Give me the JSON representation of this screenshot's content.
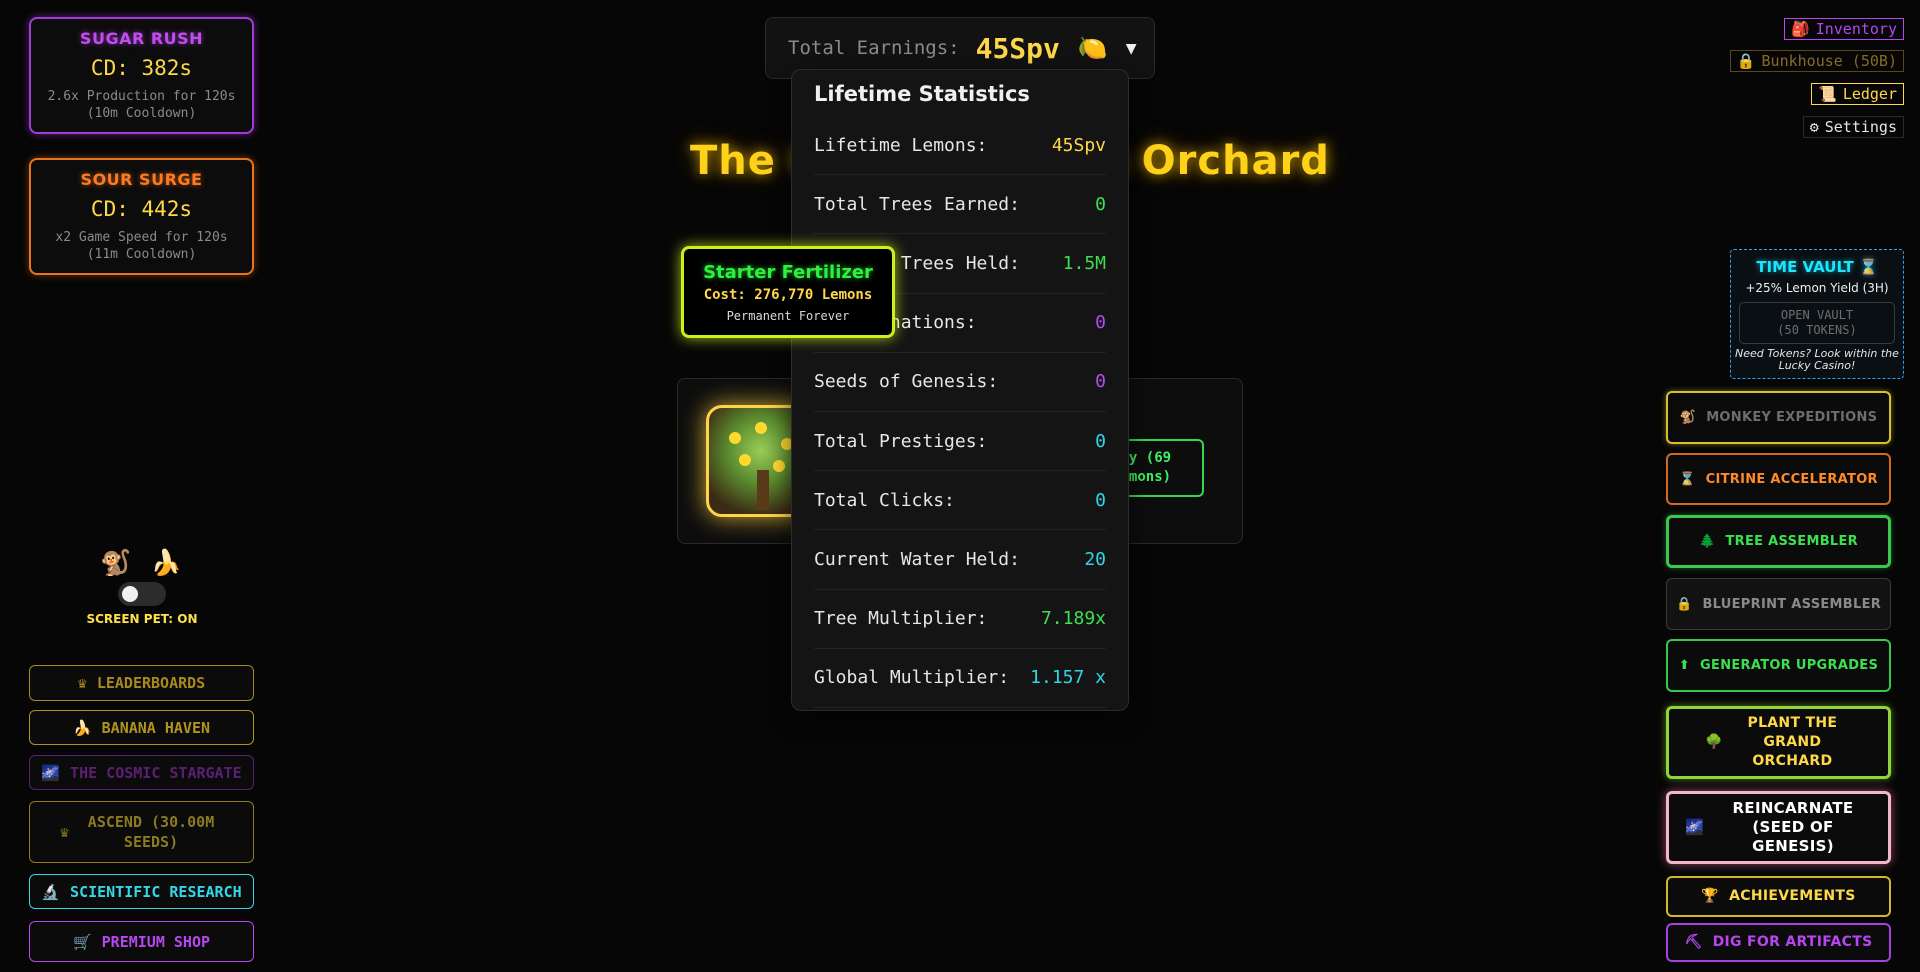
{
  "abilities": {
    "sugar": {
      "title": "SUGAR RUSH",
      "cd": "CD: 382s",
      "desc1": "2.6x Production for 120s",
      "desc2": "(10m Cooldown)"
    },
    "sour": {
      "title": "SOUR SURGE",
      "cd": "CD: 442s",
      "desc1": "x2 Game Speed for 120s",
      "desc2": "(11m Cooldown)"
    }
  },
  "pet": {
    "emojis": "🐒 🍌",
    "label": "SCREEN PET: ON",
    "toggle_on": true
  },
  "left_nav": [
    {
      "icon": "♛",
      "label": "LEADERBOARDS",
      "color": "#a8891e"
    },
    {
      "icon": "🍌",
      "label": "BANANA HAVEN",
      "color": "#b0921f"
    },
    {
      "icon": "🌌",
      "label": "THE COSMIC STARGATE",
      "color": "#5b1f73"
    },
    {
      "icon": "♛",
      "label": "ASCEND (30.00M SEEDS)",
      "color": "#8b7a22"
    },
    {
      "icon": "🔬",
      "label": "SCIENTIFIC RESEARCH",
      "color": "#35d6e8"
    },
    {
      "icon": "🛒",
      "label": "PREMIUM SHOP",
      "color": "#b546f0"
    }
  ],
  "earnings": {
    "label": "Total Earnings:",
    "value": "45Spv",
    "icon": "🍋",
    "caret": "▼"
  },
  "game_title": "The Cosmic Lemon Orchard",
  "buy_button": "y (69\nmons)",
  "stats": {
    "title": "Lifetime Statistics",
    "rows": [
      {
        "key": "Lifetime Lemons:",
        "value": "45Spv",
        "color": "#ffd84a"
      },
      {
        "key": "Total Trees Earned:",
        "value": "0",
        "color": "#3ce050"
      },
      {
        "key": "Current Trees Held:",
        "value": "1.5M",
        "color": "#3ce050"
      },
      {
        "key": "Reincarnations:",
        "value": "0",
        "color": "#b44cf0"
      },
      {
        "key": "Seeds of Genesis:",
        "value": "0",
        "color": "#b44cf0"
      },
      {
        "key": "Total Prestiges:",
        "value": "0",
        "color": "#2fd6e8"
      },
      {
        "key": "Total Clicks:",
        "value": "0",
        "color": "#2fd6e8"
      },
      {
        "key": "Current Water Held:",
        "value": "20",
        "color": "#2fd6e8"
      },
      {
        "key": "Tree Multiplier:",
        "value": "7.189x",
        "color": "#3ce050"
      },
      {
        "key": "Global Multiplier:",
        "value": "1.157 x",
        "color": "#2fd6e8"
      }
    ]
  },
  "tooltip": {
    "title": "Starter Fertilizer",
    "cost": "Cost: 276,770 Lemons",
    "note": "Permanent Forever"
  },
  "top_links": {
    "inventory": {
      "icon": "🎒",
      "label": "Inventory",
      "color": "#b546f0"
    },
    "bunkhouse": {
      "icon": "🔒",
      "label": "Bunkhouse (50B)",
      "color": "#8a6a22"
    },
    "ledger": {
      "icon": "📜",
      "label": "Ledger",
      "color": "#ffd84a"
    },
    "settings": {
      "icon": "⚙",
      "label": "Settings",
      "color": "#e6e6e6"
    }
  },
  "vault": {
    "title": "TIME VAULT ⌛",
    "yield": "+25% Lemon Yield (3H)",
    "button": "OPEN VAULT\n(50 TOKENS)",
    "note": "Need Tokens? Look within the Lucky Casino!"
  },
  "right_nav": [
    {
      "icon": "🐒",
      "label": "MONKEY EXPEDITIONS",
      "color": "#6d6d6d"
    },
    {
      "icon": "⌛",
      "label": "CITRINE ACCELERATOR",
      "color": "#ff8a2a"
    },
    {
      "icon": "🌲",
      "label": "TREE ASSEMBLER",
      "color": "#3ce050"
    },
    {
      "icon": "🔒",
      "label": "BLUEPRINT ASSEMBLER",
      "color": "#8a8a8a"
    },
    {
      "icon": "⬆",
      "label": "GENERATOR UPGRADES",
      "color": "#3ce050"
    },
    {
      "icon": "🌳",
      "label": "PLANT THE GRAND ORCHARD",
      "color": "#ffd84a"
    },
    {
      "icon": "🌌",
      "label": "REINCARNATE (SEED OF GENESIS)",
      "color": "#ffffff"
    },
    {
      "icon": "🏆",
      "label": "ACHIEVEMENTS",
      "color": "#ffd84a"
    },
    {
      "icon": "⛏",
      "label": "DIG FOR ARTIFACTS",
      "color": "#b546f0"
    }
  ]
}
